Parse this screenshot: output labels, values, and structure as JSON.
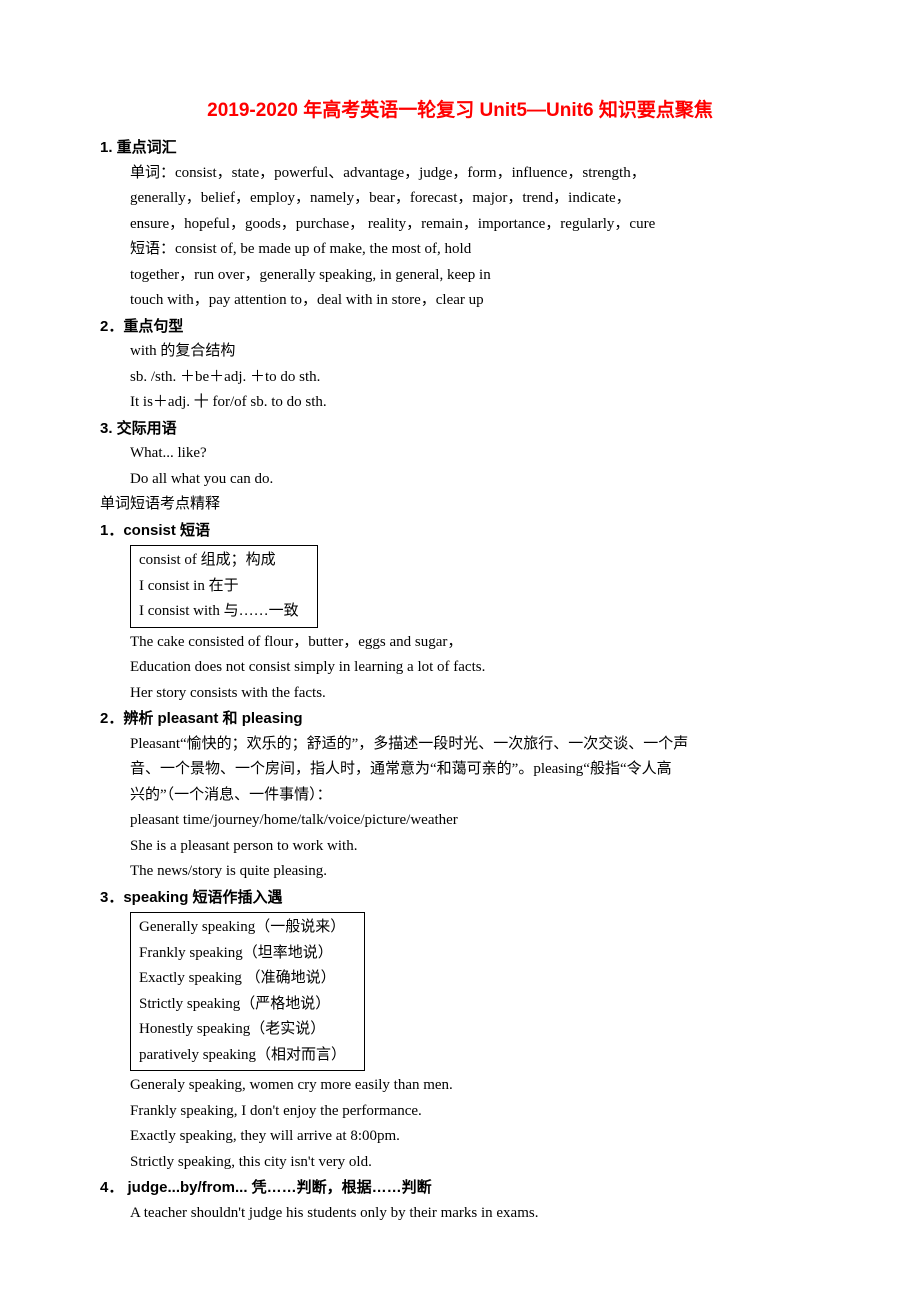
{
  "title": "2019-2020 年高考英语一轮复习 Unit5—Unit6 知识要点聚焦",
  "sec1": {
    "h": "1. 重点词汇",
    "l1": "单词：consist，state，powerful、advantage，judge，form，influence，strength，",
    "l2": "generally，belief，employ，namely，bear，forecast，major，trend，indicate，",
    "l3": "ensure，hopeful，goods，purchase， reality，remain，importance，regularly，cure",
    "l4": "短语：consist of, be made up of make, the most of, hold",
    "l5": "together，run over，generally speaking, in general, keep in",
    "l6": "touch with，pay attention to，deal with in store，clear up"
  },
  "sec2": {
    "h": "2．重点句型",
    "l1": "with 的复合结构",
    "l2": "sb. /sth. ＋be＋adj. ＋to do sth.",
    "l3": "It is＋adj. 十 for/of sb. to do sth."
  },
  "sec3": {
    "h": "3. 交际用语",
    "l1": "What... like?",
    "l2": "Do all what you can do."
  },
  "sub": "单词短语考点精释",
  "sec4": {
    "h": "1．consist 短语",
    "b1": "consist of 组成；构成",
    "b2": "I consist in 在于",
    "b3": "I consist with 与……一致",
    "l1": "The cake consisted of flour，butter，eggs and sugar，",
    "l2": "Education does not consist simply in learning a lot of facts.",
    "l3": "Her story consists with the facts."
  },
  "sec5": {
    "h": "2．辨析 pleasant 和 pleasing",
    "l1": "Pleasant“愉快的；欢乐的；舒适的”，多描述一段时光、一次旅行、一次交谈、一个声",
    "l2": "音、一个景物、一个房间，指人时，通常意为“和蔼可亲的”。pleasing“般指“令人高",
    "l3": "兴的”（一个消息、一件事情）：",
    "l4": "pleasant time/journey/home/talk/voice/picture/weather",
    "l5": "She is a pleasant person to work with.",
    "l6": "The news/story is quite pleasing."
  },
  "sec6": {
    "h": "3．speaking 短语作插入遇",
    "b1": "Generally speaking（一般说来）",
    "b2": "Frankly speaking（坦率地说）",
    "b3": "Exactly speaking （准确地说）",
    "b4": "Strictly speaking（严格地说）",
    "b5": "Honestly speaking（老实说）",
    "b6": "paratively speaking（相对而言）",
    "l1": "Generaly speaking, women cry more easily than men.",
    "l2": "Frankly speaking, I don't enjoy the performance.",
    "l3": "Exactly speaking, they will arrive at 8:00pm.",
    "l4": "Strictly speaking, this city isn't very old."
  },
  "sec7": {
    "h": "4． judge...by/from... 凭……判断，根据……判断",
    "l1": "A teacher shouldn't judge his students only by their marks in exams."
  }
}
